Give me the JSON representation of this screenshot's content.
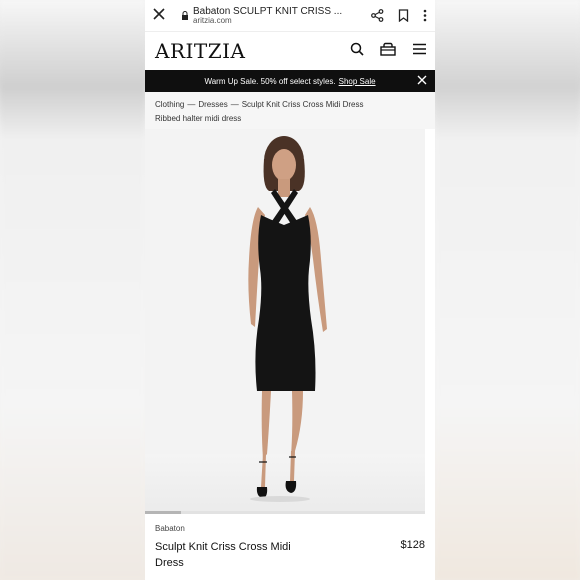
{
  "browser": {
    "tab_title": "Babaton SCULPT KNIT CRISS ...",
    "domain": "aritzia.com"
  },
  "site": {
    "logo": "ARITZIA"
  },
  "promo": {
    "text": "Warm Up Sale. 50% off select styles.",
    "link": "Shop Sale"
  },
  "breadcrumb": {
    "items": [
      "Clothing",
      "Dresses",
      "Sculpt Knit Criss Cross Midi Dress"
    ],
    "separator": "—"
  },
  "product": {
    "subtitle": "Ribbed halter midi dress",
    "brand": "Babaton",
    "name": "Sculpt Knit Criss Cross Midi Dress",
    "price": "$128",
    "image_progress": 0.13
  },
  "colors": {
    "banner_bg": "#0f0f0f",
    "dress": "#141414",
    "skin": "#c99a7d",
    "hair": "#4a3226"
  },
  "icons": [
    "close-icon",
    "lock-icon",
    "share-icon",
    "bookmark-icon",
    "more-vert-icon",
    "search-icon",
    "bag-icon",
    "menu-icon",
    "promo-close-icon"
  ]
}
